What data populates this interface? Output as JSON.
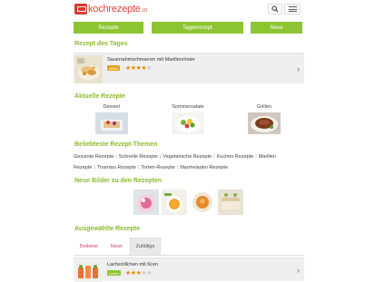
{
  "header": {
    "logo_brand": "kochrezepte",
    "logo_tld": ".at"
  },
  "nav": {
    "tab1": "Rezepte",
    "tab2": "Tagesrezept",
    "tab3": "Neue"
  },
  "recipe_of_day": {
    "section_title": "Rezept des Tages",
    "name": "Sauerrahmschmarren mit Marillenröster",
    "difficulty": "Mittel",
    "rating": 4,
    "difficulty_color": "#e8a21b"
  },
  "current": {
    "section_title": "Aktuelle Rezepte",
    "categories": [
      {
        "label": "Dessert"
      },
      {
        "label": "Sommersalate"
      },
      {
        "label": "Grillen"
      }
    ]
  },
  "themes": {
    "section_title": "Beliebteste Rezept-Themen",
    "items": [
      "Gesunde Rezepte",
      "Schnelle Rezepte",
      "Vegetarische Rezepte",
      "Kuchen Rezepte",
      "Marillen Rezepte",
      "Tiramisu Rezepte",
      "Torten-Rezepte",
      "Marmeladen Rezepte"
    ]
  },
  "new_pics": {
    "section_title": "Neue Bilder zu den Rezepten"
  },
  "selected": {
    "section_title": "Ausgewählte Rezepte",
    "tabs": [
      "Beliebte",
      "Neue",
      "Zufällige"
    ],
    "recipe": {
      "name": "Lachsröllchen mit Kren",
      "difficulty": "Leicht",
      "rating": 3,
      "difficulty_color": "#8cc432"
    }
  },
  "colors": {
    "accent_green": "#8cc432",
    "title_green": "#8cba2a",
    "brand_red": "#e0443a",
    "link_pink": "#d0426b"
  }
}
